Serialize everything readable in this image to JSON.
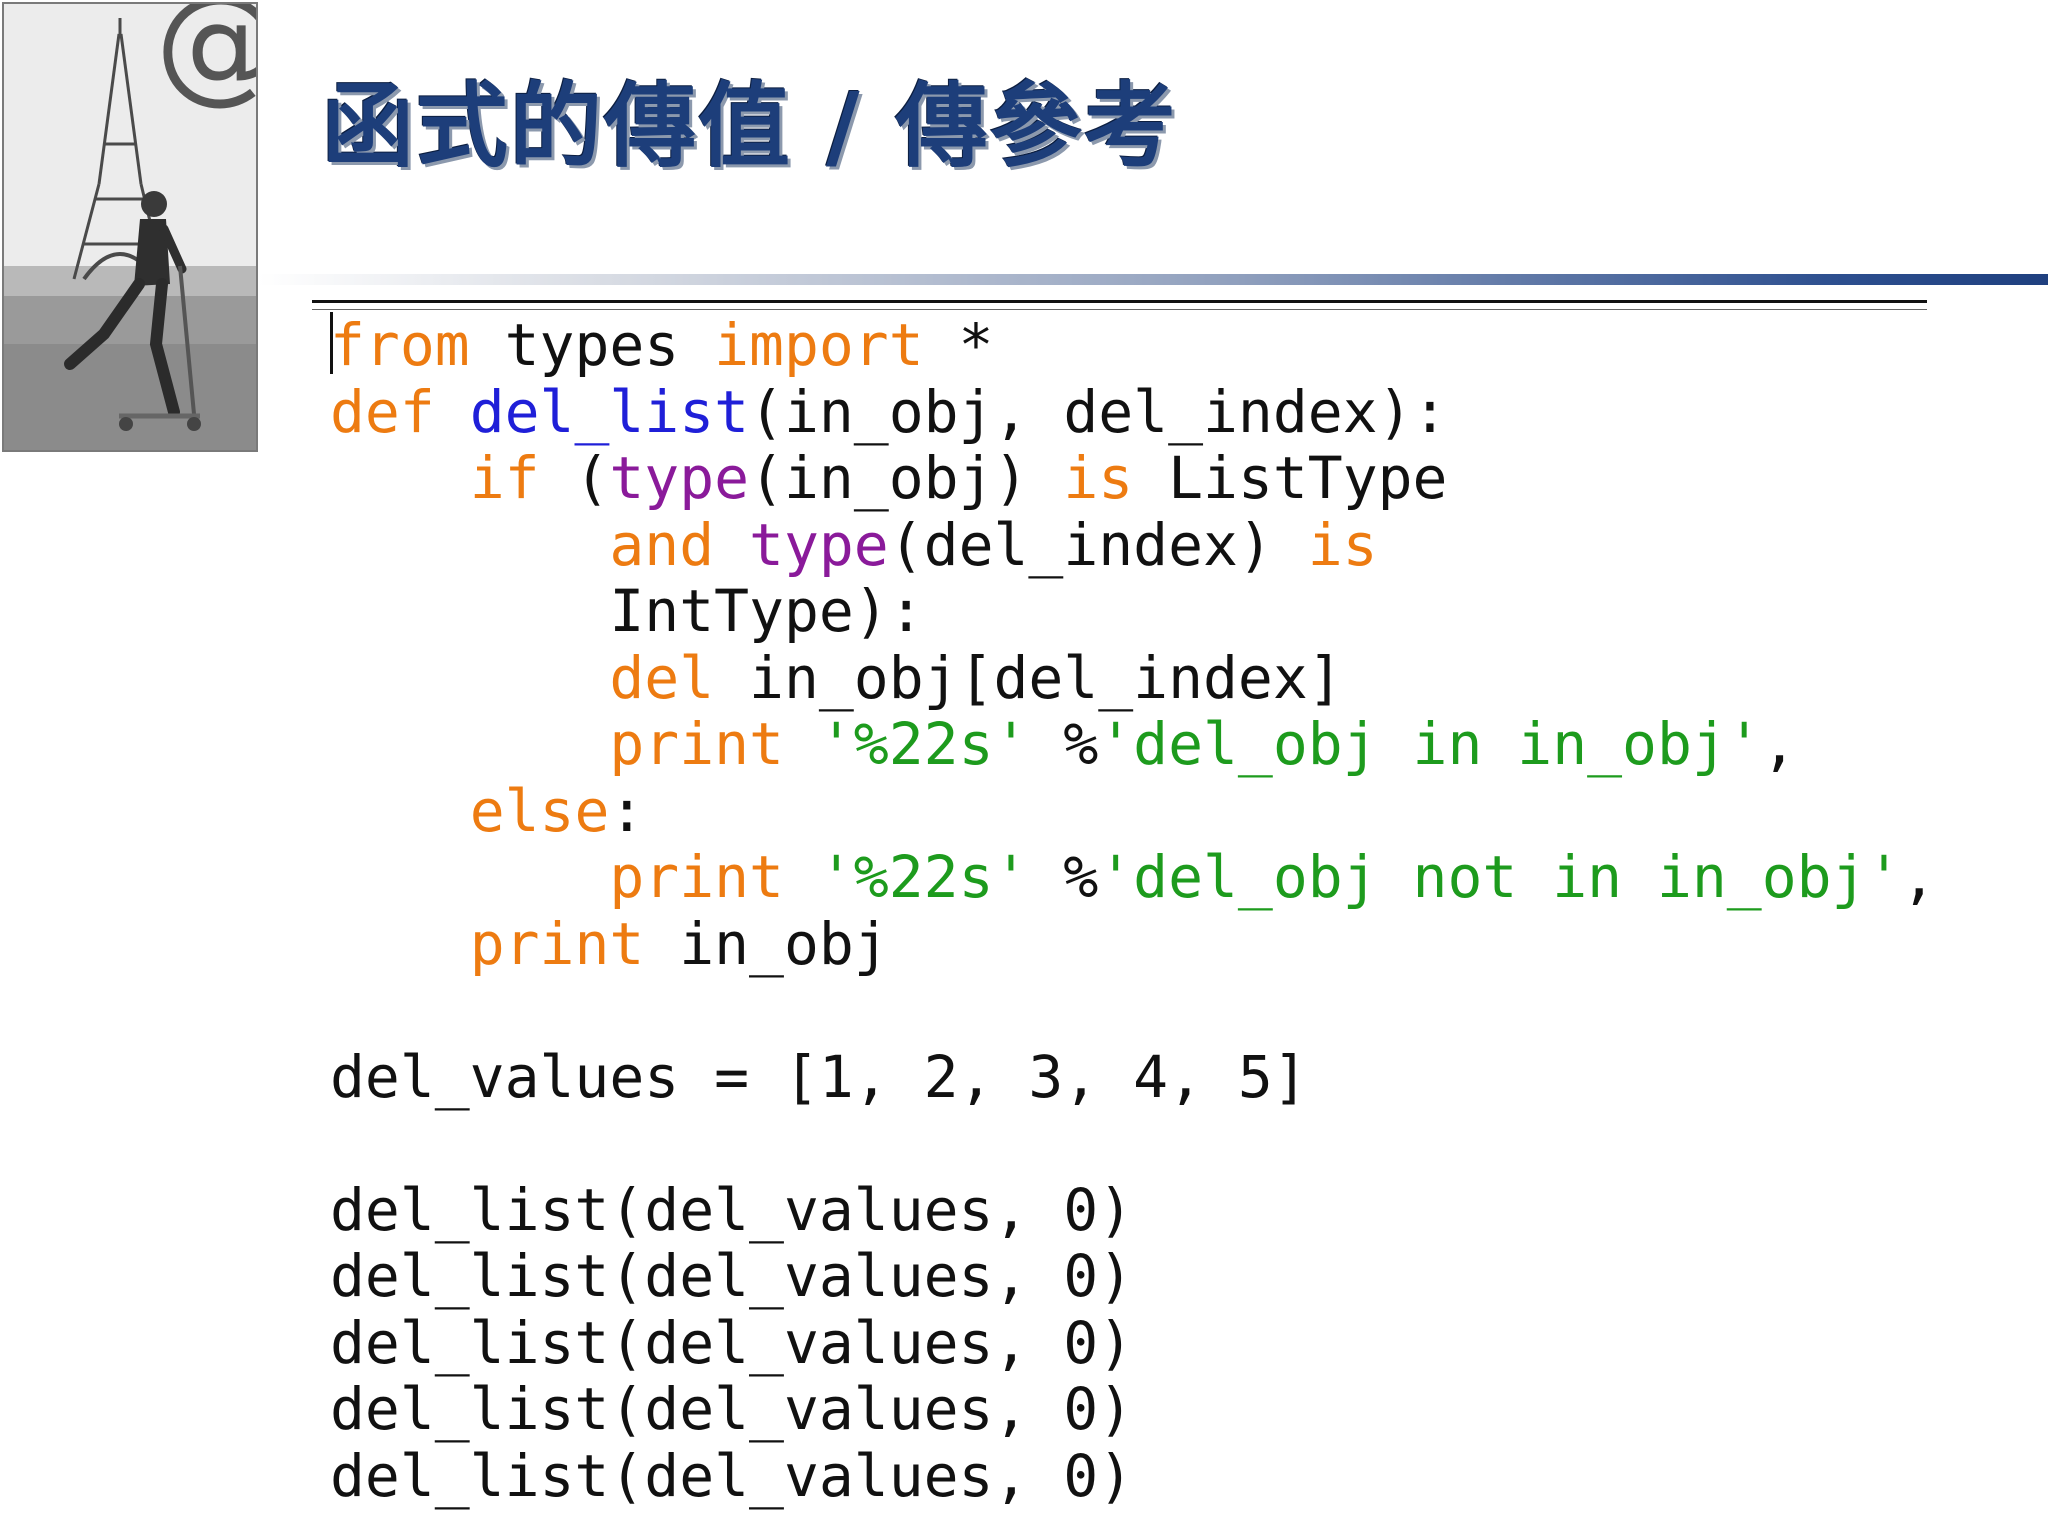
{
  "photo": {
    "logo_text": "@"
  },
  "title": "函式的傳值 / 傳參考",
  "code": {
    "lines": [
      [
        {
          "t": "from",
          "c": "kw"
        },
        {
          "t": " types "
        },
        {
          "t": "import",
          "c": "kw"
        },
        {
          "t": " *"
        }
      ],
      [
        {
          "t": "def",
          "c": "kw"
        },
        {
          "t": " "
        },
        {
          "t": "del_list",
          "c": "fn"
        },
        {
          "t": "(in_obj, del_index):"
        }
      ],
      [
        {
          "t": "    "
        },
        {
          "t": "if",
          "c": "kw"
        },
        {
          "t": " ("
        },
        {
          "t": "type",
          "c": "bi"
        },
        {
          "t": "(in_obj) "
        },
        {
          "t": "is",
          "c": "kw"
        },
        {
          "t": " ListType"
        }
      ],
      [
        {
          "t": "        "
        },
        {
          "t": "and",
          "c": "kw"
        },
        {
          "t": " "
        },
        {
          "t": "type",
          "c": "bi"
        },
        {
          "t": "(del_index) "
        },
        {
          "t": "is",
          "c": "kw"
        }
      ],
      [
        {
          "t": "        IntType):"
        }
      ],
      [
        {
          "t": "        "
        },
        {
          "t": "del",
          "c": "kw"
        },
        {
          "t": " in_obj[del_index]"
        }
      ],
      [
        {
          "t": "        "
        },
        {
          "t": "print",
          "c": "kw"
        },
        {
          "t": " "
        },
        {
          "t": "'%22s'",
          "c": "str"
        },
        {
          "t": " %"
        },
        {
          "t": "'del_obj in in_obj'",
          "c": "str"
        },
        {
          "t": ","
        }
      ],
      [
        {
          "t": "    "
        },
        {
          "t": "else",
          "c": "kw"
        },
        {
          "t": ":"
        }
      ],
      [
        {
          "t": "        "
        },
        {
          "t": "print",
          "c": "kw"
        },
        {
          "t": " "
        },
        {
          "t": "'%22s'",
          "c": "str"
        },
        {
          "t": " %"
        },
        {
          "t": "'del_obj not in in_obj'",
          "c": "str"
        },
        {
          "t": ","
        }
      ],
      [
        {
          "t": "    "
        },
        {
          "t": "print",
          "c": "kw"
        },
        {
          "t": " in_obj"
        }
      ],
      [
        {
          "t": ""
        }
      ],
      [
        {
          "t": "del_values = [1, 2, 3, 4, 5]"
        }
      ],
      [
        {
          "t": ""
        }
      ],
      [
        {
          "t": "del_list(del_values, 0)"
        }
      ],
      [
        {
          "t": "del_list(del_values, 0)"
        }
      ],
      [
        {
          "t": "del_list(del_values, 0)"
        }
      ],
      [
        {
          "t": "del_list(del_values, 0)"
        }
      ],
      [
        {
          "t": "del_list(del_values, 0)"
        }
      ]
    ]
  }
}
